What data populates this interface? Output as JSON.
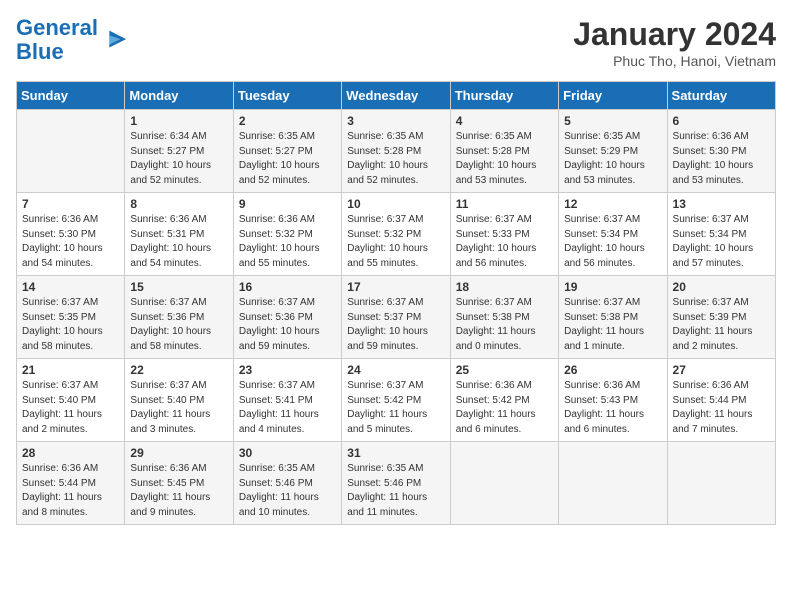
{
  "logo": {
    "line1": "General",
    "line2": "Blue"
  },
  "title": "January 2024",
  "subtitle": "Phuc Tho, Hanoi, Vietnam",
  "days_of_week": [
    "Sunday",
    "Monday",
    "Tuesday",
    "Wednesday",
    "Thursday",
    "Friday",
    "Saturday"
  ],
  "weeks": [
    [
      {
        "day": "",
        "info": ""
      },
      {
        "day": "1",
        "info": "Sunrise: 6:34 AM\nSunset: 5:27 PM\nDaylight: 10 hours\nand 52 minutes."
      },
      {
        "day": "2",
        "info": "Sunrise: 6:35 AM\nSunset: 5:27 PM\nDaylight: 10 hours\nand 52 minutes."
      },
      {
        "day": "3",
        "info": "Sunrise: 6:35 AM\nSunset: 5:28 PM\nDaylight: 10 hours\nand 52 minutes."
      },
      {
        "day": "4",
        "info": "Sunrise: 6:35 AM\nSunset: 5:28 PM\nDaylight: 10 hours\nand 53 minutes."
      },
      {
        "day": "5",
        "info": "Sunrise: 6:35 AM\nSunset: 5:29 PM\nDaylight: 10 hours\nand 53 minutes."
      },
      {
        "day": "6",
        "info": "Sunrise: 6:36 AM\nSunset: 5:30 PM\nDaylight: 10 hours\nand 53 minutes."
      }
    ],
    [
      {
        "day": "7",
        "info": "Sunrise: 6:36 AM\nSunset: 5:30 PM\nDaylight: 10 hours\nand 54 minutes."
      },
      {
        "day": "8",
        "info": "Sunrise: 6:36 AM\nSunset: 5:31 PM\nDaylight: 10 hours\nand 54 minutes."
      },
      {
        "day": "9",
        "info": "Sunrise: 6:36 AM\nSunset: 5:32 PM\nDaylight: 10 hours\nand 55 minutes."
      },
      {
        "day": "10",
        "info": "Sunrise: 6:37 AM\nSunset: 5:32 PM\nDaylight: 10 hours\nand 55 minutes."
      },
      {
        "day": "11",
        "info": "Sunrise: 6:37 AM\nSunset: 5:33 PM\nDaylight: 10 hours\nand 56 minutes."
      },
      {
        "day": "12",
        "info": "Sunrise: 6:37 AM\nSunset: 5:34 PM\nDaylight: 10 hours\nand 56 minutes."
      },
      {
        "day": "13",
        "info": "Sunrise: 6:37 AM\nSunset: 5:34 PM\nDaylight: 10 hours\nand 57 minutes."
      }
    ],
    [
      {
        "day": "14",
        "info": "Sunrise: 6:37 AM\nSunset: 5:35 PM\nDaylight: 10 hours\nand 58 minutes."
      },
      {
        "day": "15",
        "info": "Sunrise: 6:37 AM\nSunset: 5:36 PM\nDaylight: 10 hours\nand 58 minutes."
      },
      {
        "day": "16",
        "info": "Sunrise: 6:37 AM\nSunset: 5:36 PM\nDaylight: 10 hours\nand 59 minutes."
      },
      {
        "day": "17",
        "info": "Sunrise: 6:37 AM\nSunset: 5:37 PM\nDaylight: 10 hours\nand 59 minutes."
      },
      {
        "day": "18",
        "info": "Sunrise: 6:37 AM\nSunset: 5:38 PM\nDaylight: 11 hours\nand 0 minutes."
      },
      {
        "day": "19",
        "info": "Sunrise: 6:37 AM\nSunset: 5:38 PM\nDaylight: 11 hours\nand 1 minute."
      },
      {
        "day": "20",
        "info": "Sunrise: 6:37 AM\nSunset: 5:39 PM\nDaylight: 11 hours\nand 2 minutes."
      }
    ],
    [
      {
        "day": "21",
        "info": "Sunrise: 6:37 AM\nSunset: 5:40 PM\nDaylight: 11 hours\nand 2 minutes."
      },
      {
        "day": "22",
        "info": "Sunrise: 6:37 AM\nSunset: 5:40 PM\nDaylight: 11 hours\nand 3 minutes."
      },
      {
        "day": "23",
        "info": "Sunrise: 6:37 AM\nSunset: 5:41 PM\nDaylight: 11 hours\nand 4 minutes."
      },
      {
        "day": "24",
        "info": "Sunrise: 6:37 AM\nSunset: 5:42 PM\nDaylight: 11 hours\nand 5 minutes."
      },
      {
        "day": "25",
        "info": "Sunrise: 6:36 AM\nSunset: 5:42 PM\nDaylight: 11 hours\nand 6 minutes."
      },
      {
        "day": "26",
        "info": "Sunrise: 6:36 AM\nSunset: 5:43 PM\nDaylight: 11 hours\nand 6 minutes."
      },
      {
        "day": "27",
        "info": "Sunrise: 6:36 AM\nSunset: 5:44 PM\nDaylight: 11 hours\nand 7 minutes."
      }
    ],
    [
      {
        "day": "28",
        "info": "Sunrise: 6:36 AM\nSunset: 5:44 PM\nDaylight: 11 hours\nand 8 minutes."
      },
      {
        "day": "29",
        "info": "Sunrise: 6:36 AM\nSunset: 5:45 PM\nDaylight: 11 hours\nand 9 minutes."
      },
      {
        "day": "30",
        "info": "Sunrise: 6:35 AM\nSunset: 5:46 PM\nDaylight: 11 hours\nand 10 minutes."
      },
      {
        "day": "31",
        "info": "Sunrise: 6:35 AM\nSunset: 5:46 PM\nDaylight: 11 hours\nand 11 minutes."
      },
      {
        "day": "",
        "info": ""
      },
      {
        "day": "",
        "info": ""
      },
      {
        "day": "",
        "info": ""
      }
    ]
  ]
}
